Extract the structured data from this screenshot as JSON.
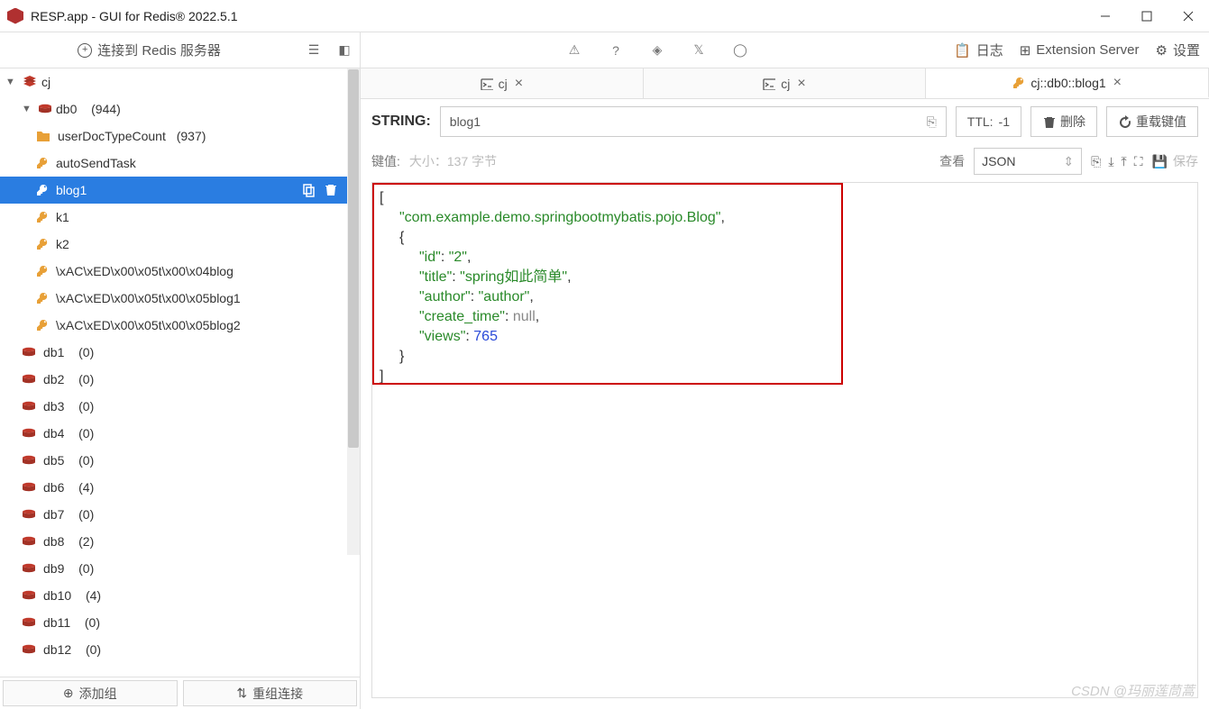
{
  "window": {
    "title": "RESP.app - GUI for Redis® 2022.5.1"
  },
  "toolbar": {
    "connect": "连接到 Redis 服务器",
    "log": "日志",
    "ext": "Extension Server",
    "settings": "设置"
  },
  "tree": {
    "connection": "cj",
    "db0": {
      "name": "db0",
      "count": "(944)"
    },
    "folder": {
      "name": "userDocTypeCount",
      "count": "(937)"
    },
    "keys": [
      "autoSendTask",
      "blog1",
      "k1",
      "k2",
      "\\xAC\\xED\\x00\\x05t\\x00\\x04blog",
      "\\xAC\\xED\\x00\\x05t\\x00\\x05blog1",
      "\\xAC\\xED\\x00\\x05t\\x00\\x05blog2"
    ],
    "dbs": [
      {
        "n": "db1",
        "c": "(0)"
      },
      {
        "n": "db2",
        "c": "(0)"
      },
      {
        "n": "db3",
        "c": "(0)"
      },
      {
        "n": "db4",
        "c": "(0)"
      },
      {
        "n": "db5",
        "c": "(0)"
      },
      {
        "n": "db6",
        "c": "(4)"
      },
      {
        "n": "db7",
        "c": "(0)"
      },
      {
        "n": "db8",
        "c": "(2)"
      },
      {
        "n": "db9",
        "c": "(0)"
      },
      {
        "n": "db10",
        "c": "(4)"
      },
      {
        "n": "db11",
        "c": "(0)"
      },
      {
        "n": "db12",
        "c": "(0)"
      }
    ]
  },
  "footer": {
    "addGroup": "添加组",
    "regroup": "重组连接"
  },
  "tabs": {
    "t1": "cj",
    "t2": "cj",
    "t3": "cj::db0::blog1"
  },
  "keybar": {
    "type": "STRING:",
    "key": "blog1",
    "ttl_label": "TTL:",
    "ttl_value": "-1",
    "delete": "删除",
    "reload": "重载键值"
  },
  "valbar": {
    "label": "键值:",
    "hint": "大小：137 字节",
    "view": "查看",
    "format": "JSON",
    "save": "保存"
  },
  "json": {
    "open": "[",
    "class": "\"com.example.demo.springbootmybatis.pojo.Blog\"",
    "obj_open": "{",
    "kv": [
      {
        "k": "\"id\"",
        "sep": ": ",
        "v": "\"2\"",
        "t": "str",
        "comma": ","
      },
      {
        "k": "\"title\"",
        "sep": ": ",
        "v": "\"spring如此简单\"",
        "t": "str",
        "comma": ","
      },
      {
        "k": "\"author\"",
        "sep": ": ",
        "v": "\"author\"",
        "t": "str",
        "comma": ","
      },
      {
        "k": "\"create_time\"",
        "sep": ": ",
        "v": "null",
        "t": "null",
        "comma": ","
      },
      {
        "k": "\"views\"",
        "sep": ": ",
        "v": "765",
        "t": "num",
        "comma": ""
      }
    ],
    "obj_close": "}",
    "close": "]"
  },
  "watermark": "CSDN @玛丽莲茼蒿"
}
